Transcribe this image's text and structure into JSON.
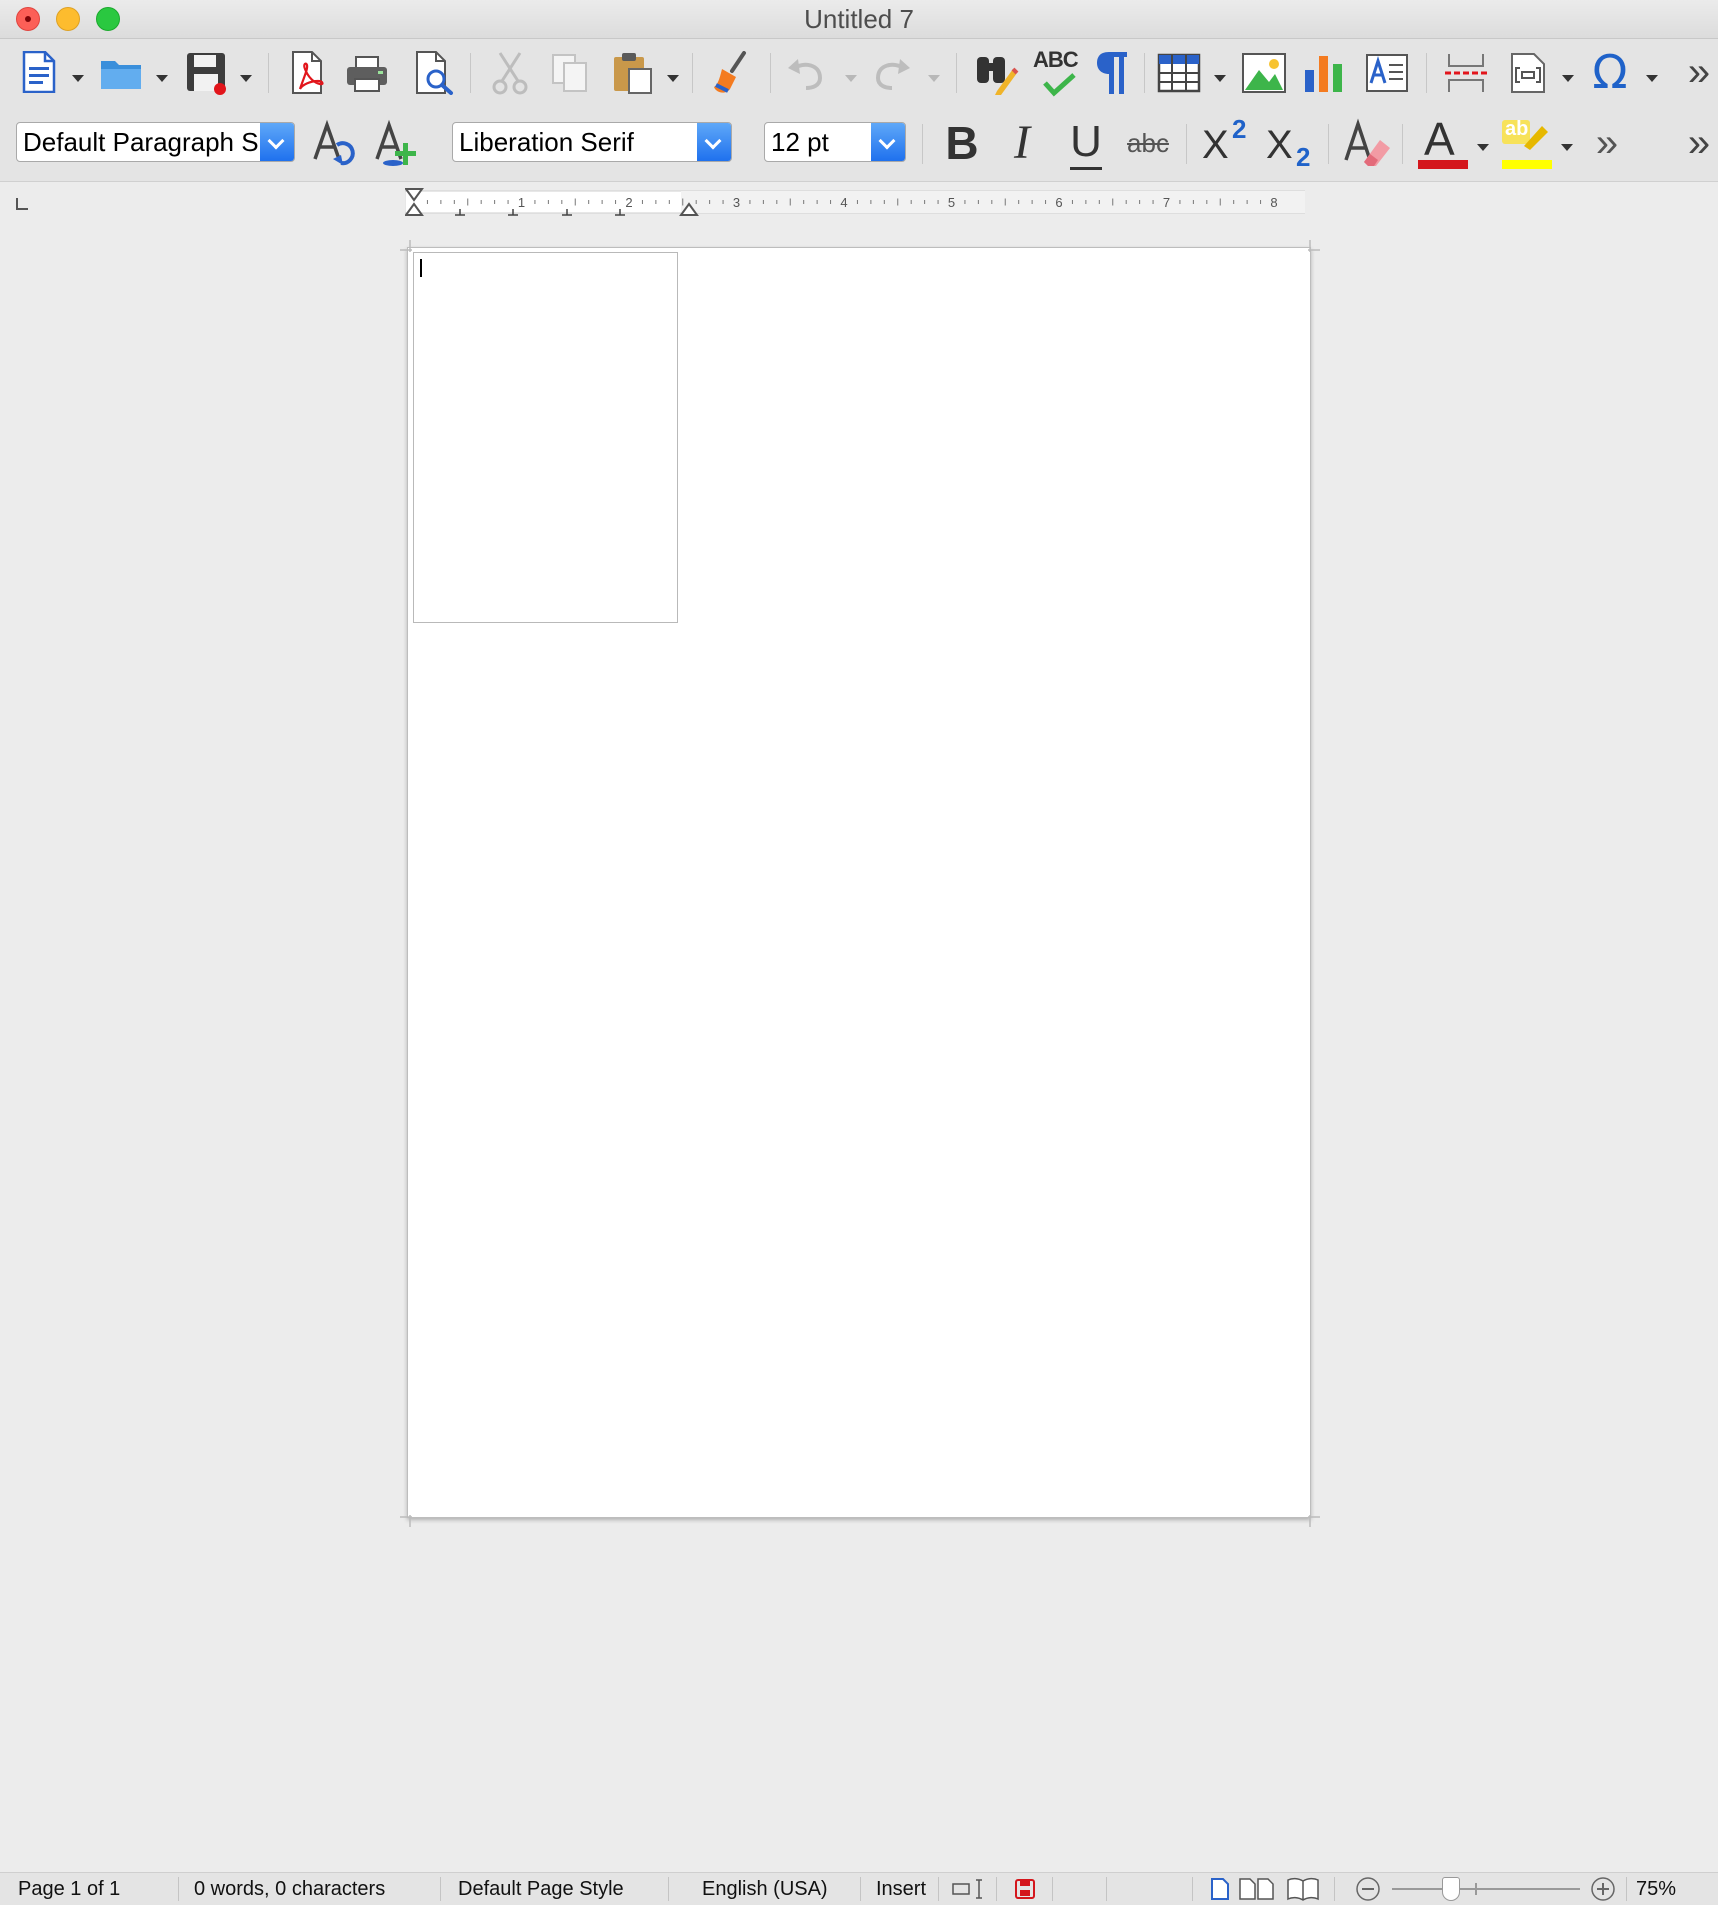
{
  "window": {
    "title": "Untitled 7"
  },
  "toolbar_standard": {
    "items": [
      "new-document-icon",
      "open-folder-icon",
      "save-icon",
      "export-pdf-icon",
      "print-icon",
      "print-preview-icon",
      "cut-icon",
      "copy-icon",
      "paste-icon",
      "clone-formatting-icon",
      "undo-icon",
      "redo-icon",
      "find-replace-icon",
      "spelling-icon",
      "formatting-marks-icon",
      "insert-table-icon",
      "insert-image-icon",
      "insert-chart-icon",
      "insert-text-box-icon",
      "page-break-icon",
      "insert-field-icon",
      "special-character-icon",
      "more-overflow-icon"
    ],
    "spelling_label": "ABC",
    "special_char_glyph": "Ω",
    "overflow_glyph": "»"
  },
  "toolbar_formatting": {
    "paragraph_style": "Default Paragraph S",
    "font_name": "Liberation Serif",
    "font_size": "12 pt",
    "bold_glyph": "B",
    "italic_glyph": "I",
    "underline_glyph": "U",
    "strikethrough_label": "abc",
    "superscript_base": "X",
    "superscript_exp": "2",
    "subscript_base": "X",
    "subscript_exp": "2",
    "font_color_glyph": "A",
    "highlight_label": "ab",
    "overflow_glyph": "»",
    "colors": {
      "font_color": "#d4161c",
      "highlight_color": "#ffff00",
      "accent_blue": "#1f71ee"
    }
  },
  "ruler": {
    "labels": [
      "1",
      "2",
      "3",
      "4",
      "5",
      "6",
      "7",
      "8"
    ]
  },
  "statusbar": {
    "page": "Page 1 of 1",
    "word_count": "0 words, 0 characters",
    "page_style": "Default Page Style",
    "language": "English (USA)",
    "insert_mode": "Insert",
    "zoom": "75%"
  }
}
